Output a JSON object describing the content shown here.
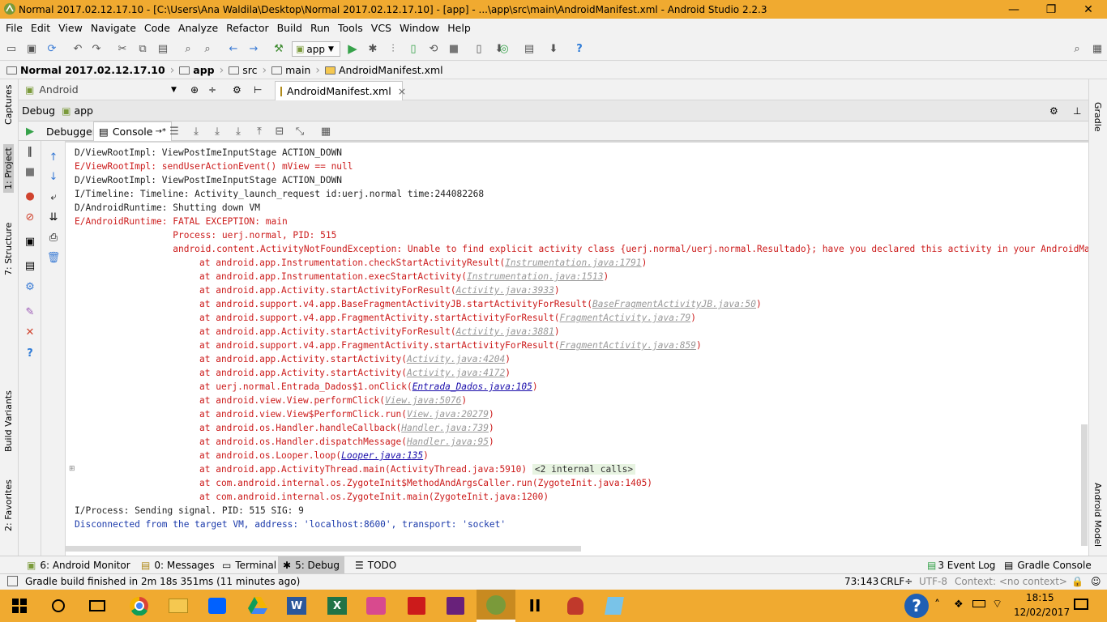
{
  "window": {
    "title": "Normal 2017.02.12.17.10 - [C:\\Users\\Ana Waldila\\Desktop\\Normal 2017.02.12.17.10] - [app] - ...\\app\\src\\main\\AndroidManifest.xml - Android Studio 2.2.3",
    "minimize": "—",
    "maximize": "❐",
    "close": "✕"
  },
  "menu": [
    "File",
    "Edit",
    "View",
    "Navigate",
    "Code",
    "Analyze",
    "Refactor",
    "Build",
    "Run",
    "Tools",
    "VCS",
    "Window",
    "Help"
  ],
  "toolbar": {
    "run_config": "app"
  },
  "breadcrumb": [
    "Normal 2017.02.12.17.10",
    "app",
    "src",
    "main",
    "AndroidManifest.xml"
  ],
  "project_view": {
    "label": "Android"
  },
  "editor_tab": {
    "label": "AndroidManifest.xml",
    "close": "×"
  },
  "debug": {
    "label": "Debug",
    "config": "app"
  },
  "subtabs": {
    "debugger": "Debugger",
    "console": "Console"
  },
  "left_tabs": {
    "captures": "Captures",
    "project": "1: Project",
    "structure": "7: Structure",
    "build_variants": "Build Variants",
    "favorites": "2: Favorites"
  },
  "right_tabs": {
    "gradle": "Gradle",
    "android_model": "Android Model"
  },
  "console_lines": [
    {
      "t": "D/ViewRootImpl: ViewPostImeInputStage ACTION_DOWN",
      "c": "d"
    },
    {
      "t": "E/ViewRootImpl: sendUserActionEvent() mView == null",
      "c": "e"
    },
    {
      "t": "D/ViewRootImpl: ViewPostImeInputStage ACTION_DOWN",
      "c": "d"
    },
    {
      "t": "I/Timeline: Timeline: Activity_launch_request id:uerj.normal time:244082268",
      "c": "i"
    },
    {
      "t": "D/AndroidRuntime: Shutting down VM",
      "c": "d"
    },
    {
      "t": "E/AndroidRuntime: FATAL EXCEPTION: main",
      "c": "e"
    },
    {
      "t": "                  Process: uerj.normal, PID: 515",
      "c": "e"
    },
    {
      "t": "                  android.content.ActivityNotFoundException: Unable to find explicit activity class {uerj.normal/uerj.normal.Resultado}; have you declared this activity in your AndroidManifest.xml?",
      "c": "e"
    }
  ],
  "stack_frames": [
    {
      "m": "at android.app.Instrumentation.checkStartActivityResult(",
      "l": "Instrumentation.java:1791",
      "s": "link"
    },
    {
      "m": "at android.app.Instrumentation.execStartActivity(",
      "l": "Instrumentation.java:1513",
      "s": "link"
    },
    {
      "m": "at android.app.Activity.startActivityForResult(",
      "l": "Activity.java:3933",
      "s": "link"
    },
    {
      "m": "at android.support.v4.app.BaseFragmentActivityJB.startActivityForResult(",
      "l": "BaseFragmentActivityJB.java:50",
      "s": "link"
    },
    {
      "m": "at android.support.v4.app.FragmentActivity.startActivityForResult(",
      "l": "FragmentActivity.java:79",
      "s": "link"
    },
    {
      "m": "at android.app.Activity.startActivityForResult(",
      "l": "Activity.java:3881",
      "s": "link"
    },
    {
      "m": "at android.support.v4.app.FragmentActivity.startActivityForResult(",
      "l": "FragmentActivity.java:859",
      "s": "link"
    },
    {
      "m": "at android.app.Activity.startActivity(",
      "l": "Activity.java:4204",
      "s": "link"
    },
    {
      "m": "at android.app.Activity.startActivity(",
      "l": "Activity.java:4172",
      "s": "link"
    },
    {
      "m": "at uerj.normal.Entrada_Dados$1.onClick(",
      "l": "Entrada_Dados.java:105",
      "s": "link2"
    },
    {
      "m": "at android.view.View.performClick(",
      "l": "View.java:5076",
      "s": "link"
    },
    {
      "m": "at android.view.View$PerformClick.run(",
      "l": "View.java:20279",
      "s": "link"
    },
    {
      "m": "at android.os.Handler.handleCallback(",
      "l": "Handler.java:739",
      "s": "link"
    },
    {
      "m": "at android.os.Handler.dispatchMessage(",
      "l": "Handler.java:95",
      "s": "link"
    },
    {
      "m": "at android.os.Looper.loop(",
      "l": "Looper.java:135",
      "s": "link2"
    }
  ],
  "tail_lines": [
    {
      "t": "at android.app.ActivityThread.main(ActivityThread.java:5910)",
      "hint": "<2 internal calls>"
    },
    {
      "t": "at com.android.internal.os.ZygoteInit$MethodAndArgsCaller.run(ZygoteInit.java:1405)"
    },
    {
      "t": "at com.android.internal.os.ZygoteInit.main(ZygoteInit.java:1200)"
    }
  ],
  "final_lines": [
    {
      "t": "I/Process: Sending signal. PID: 515 SIG: 9",
      "c": "i"
    },
    {
      "t": "Disconnected from the target VM, address: 'localhost:8600', transport: 'socket'",
      "c": "blue"
    }
  ],
  "bottom_tabs": [
    {
      "label": "6: Android Monitor"
    },
    {
      "label": "0: Messages"
    },
    {
      "label": "Terminal"
    },
    {
      "label": "5: Debug"
    },
    {
      "label": "TODO"
    }
  ],
  "bottom_right_tabs": [
    {
      "label": "3 Event Log"
    },
    {
      "label": "Gradle Console"
    }
  ],
  "status": {
    "message": "Gradle build finished in 2m 18s 351ms (11 minutes ago)",
    "position": "73:143",
    "line_sep": "CRLF÷",
    "encoding": "UTF-8",
    "context": "Context: <no context>"
  },
  "taskbar": {
    "time": "18:15",
    "date": "12/02/2017"
  }
}
